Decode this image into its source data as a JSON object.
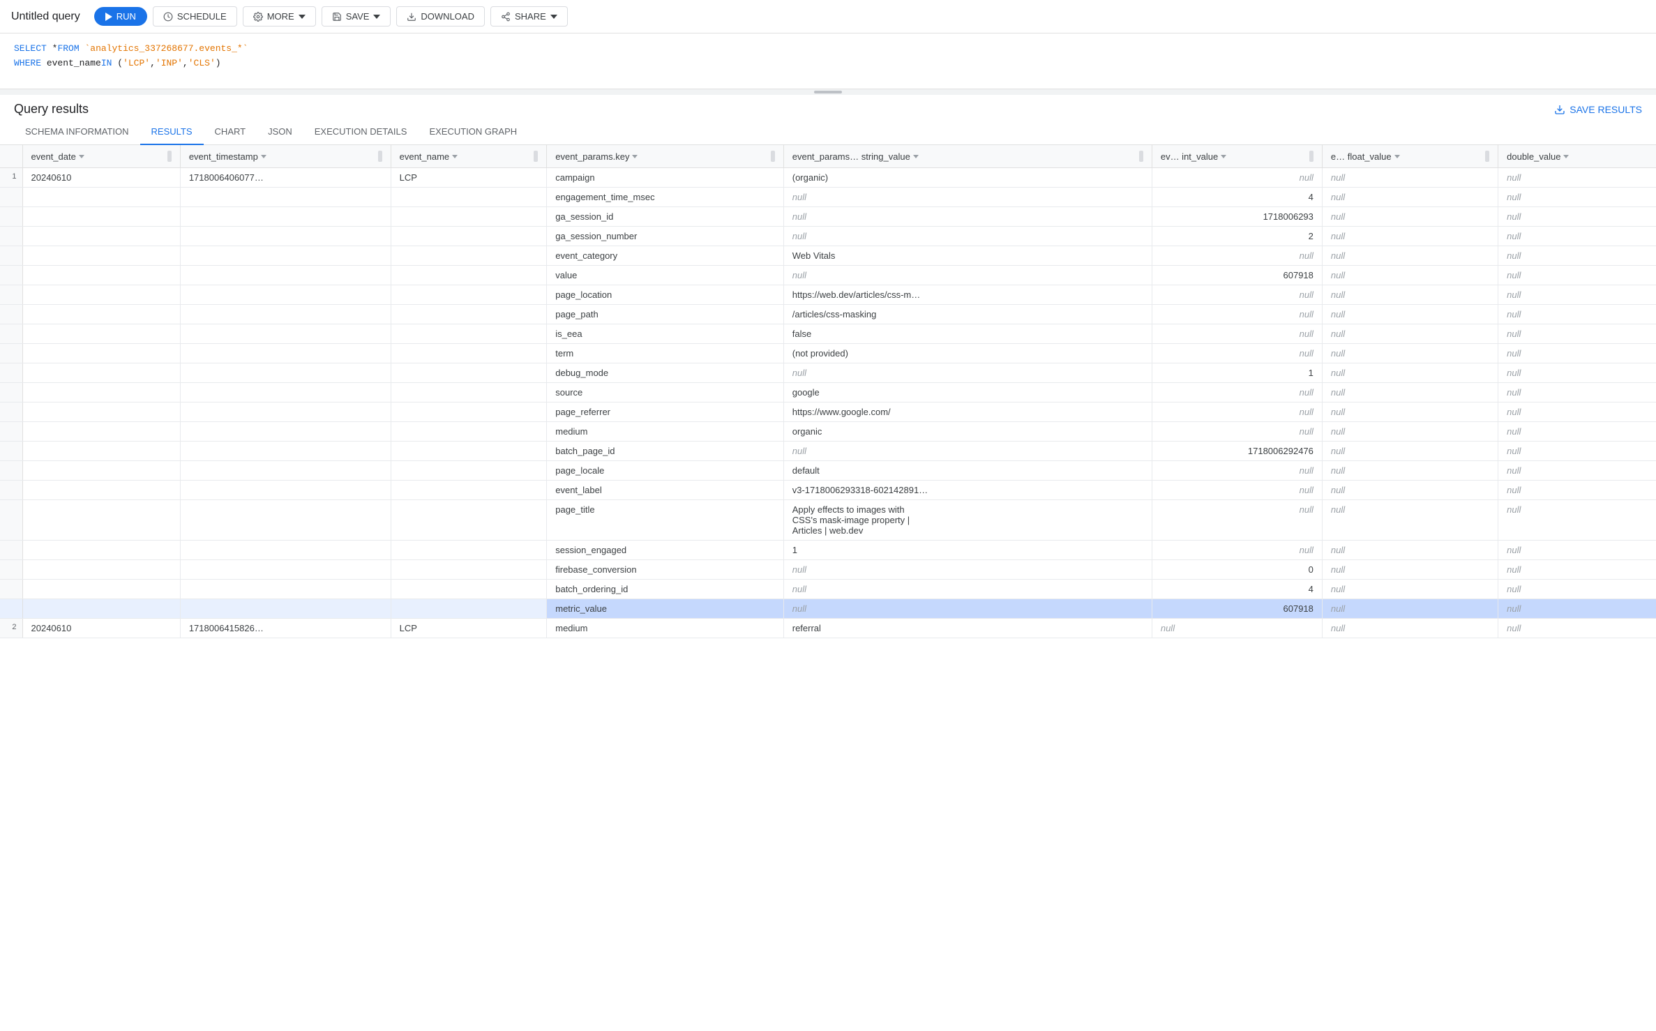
{
  "title": "Untitled query",
  "toolbar": {
    "run_label": "RUN",
    "schedule_label": "SCHEDULE",
    "more_label": "MORE",
    "save_label": "SAVE",
    "download_label": "DOWNLOAD",
    "share_label": "SHARE",
    "save_results_label": "SAVE RESULTS"
  },
  "sql": {
    "line1": "SELECT * FROM `analytics_337268677.events_*`",
    "line2": "WHERE event_name IN ('LCP', 'INP', 'CLS')"
  },
  "results": {
    "title": "Query results",
    "tabs": [
      {
        "id": "schema-info",
        "label": "SCHEMA INFORMATION"
      },
      {
        "id": "results",
        "label": "RESULTS",
        "active": true
      },
      {
        "id": "chart",
        "label": "CHART"
      },
      {
        "id": "json",
        "label": "JSON"
      },
      {
        "id": "execution-details",
        "label": "EXECUTION DETAILS"
      },
      {
        "id": "execution-graph",
        "label": "EXECUTION GRAPH"
      }
    ],
    "columns": [
      {
        "id": "row-num",
        "label": ""
      },
      {
        "id": "event-date",
        "label": "event_date"
      },
      {
        "id": "event-timestamp",
        "label": "event_timestamp"
      },
      {
        "id": "event-name",
        "label": "event_name"
      },
      {
        "id": "params-key",
        "label": "event_params.key"
      },
      {
        "id": "string-value",
        "label": "event_params… string_value"
      },
      {
        "id": "int-value",
        "label": "ev… int_value"
      },
      {
        "id": "float-value",
        "label": "e… float_value"
      },
      {
        "id": "double-value",
        "label": "double_value"
      }
    ],
    "rows": [
      {
        "row_num": "1",
        "event_date": "20240610",
        "event_timestamp": "1718006406077…",
        "event_name": "LCP",
        "params_key": "campaign",
        "string_value": "(organic)",
        "int_value": "",
        "int_null": true,
        "float_value": "",
        "float_null": true,
        "double_value": "",
        "double_null": true
      }
    ],
    "expanded_params": [
      {
        "key": "campaign",
        "string_value": "(organic)",
        "int_value": null,
        "float_value": null,
        "double_value": null
      },
      {
        "key": "engagement_time_msec",
        "string_value": null,
        "int_value": "4",
        "float_value": null,
        "double_value": null
      },
      {
        "key": "ga_session_id",
        "string_value": null,
        "int_value": "1718006293",
        "float_value": null,
        "double_value": null
      },
      {
        "key": "ga_session_number",
        "string_value": null,
        "int_value": "2",
        "float_value": null,
        "double_value": null
      },
      {
        "key": "event_category",
        "string_value": "Web Vitals",
        "int_value": null,
        "float_value": null,
        "double_value": null
      },
      {
        "key": "value",
        "string_value": null,
        "int_value": "607918",
        "float_value": null,
        "double_value": null
      },
      {
        "key": "page_location",
        "string_value": "https://web.dev/articles/css-m…",
        "int_value": null,
        "float_value": null,
        "double_value": null
      },
      {
        "key": "page_path",
        "string_value": "/articles/css-masking",
        "int_value": null,
        "float_value": null,
        "double_value": null
      },
      {
        "key": "is_eea",
        "string_value": "false",
        "int_value": null,
        "float_value": null,
        "double_value": null
      },
      {
        "key": "term",
        "string_value": "(not provided)",
        "int_value": null,
        "float_value": null,
        "double_value": null
      },
      {
        "key": "debug_mode",
        "string_value": null,
        "int_value": "1",
        "float_value": null,
        "double_value": null
      },
      {
        "key": "source",
        "string_value": "google",
        "int_value": null,
        "float_value": null,
        "double_value": null
      },
      {
        "key": "page_referrer",
        "string_value": "https://www.google.com/",
        "int_value": null,
        "float_value": null,
        "double_value": null
      },
      {
        "key": "medium",
        "string_value": "organic",
        "int_value": null,
        "float_value": null,
        "double_value": null
      },
      {
        "key": "batch_page_id",
        "string_value": null,
        "int_value": "1718006292476",
        "float_value": null,
        "double_value": null
      },
      {
        "key": "page_locale",
        "string_value": "default",
        "int_value": null,
        "float_value": null,
        "double_value": null
      },
      {
        "key": "event_label",
        "string_value": "v3-1718006293318-602142891…",
        "int_value": null,
        "float_value": null,
        "double_value": null
      },
      {
        "key": "page_title",
        "string_value": "Apply effects to images with\nCSS's mask-image property  |\nArticles | web.dev",
        "int_value": null,
        "float_value": null,
        "double_value": null
      },
      {
        "key": "session_engaged",
        "string_value": "1",
        "int_value": null,
        "float_value": null,
        "double_value": null
      },
      {
        "key": "firebase_conversion",
        "string_value": null,
        "int_value": "0",
        "float_value": null,
        "double_value": null
      },
      {
        "key": "batch_ordering_id",
        "string_value": null,
        "int_value": "4",
        "float_value": null,
        "double_value": null
      },
      {
        "key": "metric_value",
        "string_value": null,
        "int_value": "607918",
        "float_value": null,
        "double_value": null,
        "highlight": true
      }
    ],
    "row2": {
      "row_num": "2",
      "event_date": "20240610",
      "event_timestamp": "1718006415826…",
      "event_name": "LCP",
      "params_key": "medium",
      "string_value": "referral",
      "int_value": null,
      "float_value": null,
      "double_value": null
    }
  }
}
